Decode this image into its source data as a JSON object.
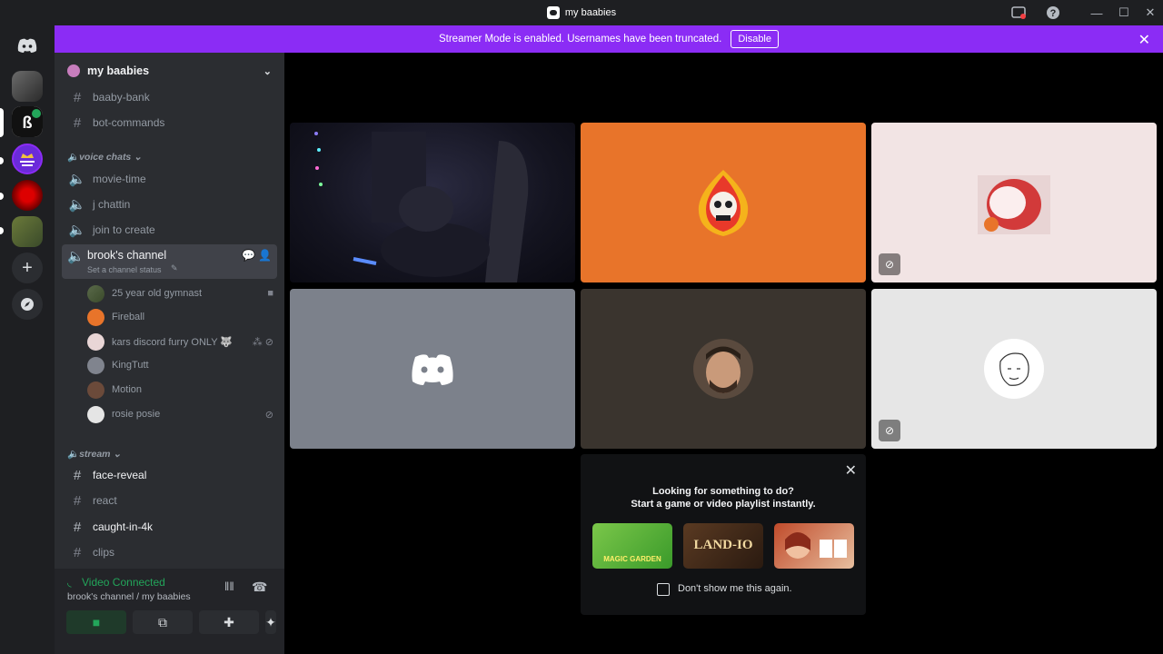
{
  "window": {
    "title": "my baabies"
  },
  "banner": {
    "text": "Streamer Mode is enabled. Usernames have been truncated.",
    "button": "Disable"
  },
  "server": {
    "name": "my baabies"
  },
  "channels_top": [
    {
      "name": "baaby-bank"
    },
    {
      "name": "bot-commands"
    }
  ],
  "voice_category": "voice chats",
  "voice_channels": [
    {
      "name": "movie-time"
    },
    {
      "name": "j chattin"
    },
    {
      "name": "join to create"
    }
  ],
  "active_channel": {
    "name": "brook's channel",
    "status": "Set a channel status"
  },
  "voice_users": [
    {
      "name": "25 year old gymnast",
      "color": "#4a5a3a",
      "icon": "video-icon"
    },
    {
      "name": "Fireball",
      "color": "#e8742a",
      "icon": ""
    },
    {
      "name": "kars discord furry ONLY 🐺",
      "color": "#e9d6d6",
      "icon": "stream-deafen-icons"
    },
    {
      "name": "KingTutt",
      "color": "#5865f2",
      "icon": ""
    },
    {
      "name": "Motion",
      "color": "#6b4a3a",
      "icon": ""
    },
    {
      "name": "rosie posie",
      "color": "#e5e5e5",
      "icon": "mic-muted-icon"
    }
  ],
  "stream_category": "stream",
  "stream_channels": [
    {
      "name": "face-reveal",
      "unread": true
    },
    {
      "name": "react",
      "unread": false
    },
    {
      "name": "caught-in-4k",
      "unread": true
    },
    {
      "name": "clips",
      "unread": false
    }
  ],
  "voice_panel": {
    "status": "Video Connected",
    "location": "brook's channel / my baabies"
  },
  "activity_popup": {
    "line1": "Looking for something to do?",
    "line2": "Start a game or video playlist instantly.",
    "activities": [
      "MAGIC GARDEN",
      "LAND-IO",
      ""
    ],
    "checkbox_label": "Don't show me this again."
  },
  "colors": {
    "accent": "#8b2cf5",
    "connected": "#23a55a",
    "tile_orange": "#e8742a"
  }
}
